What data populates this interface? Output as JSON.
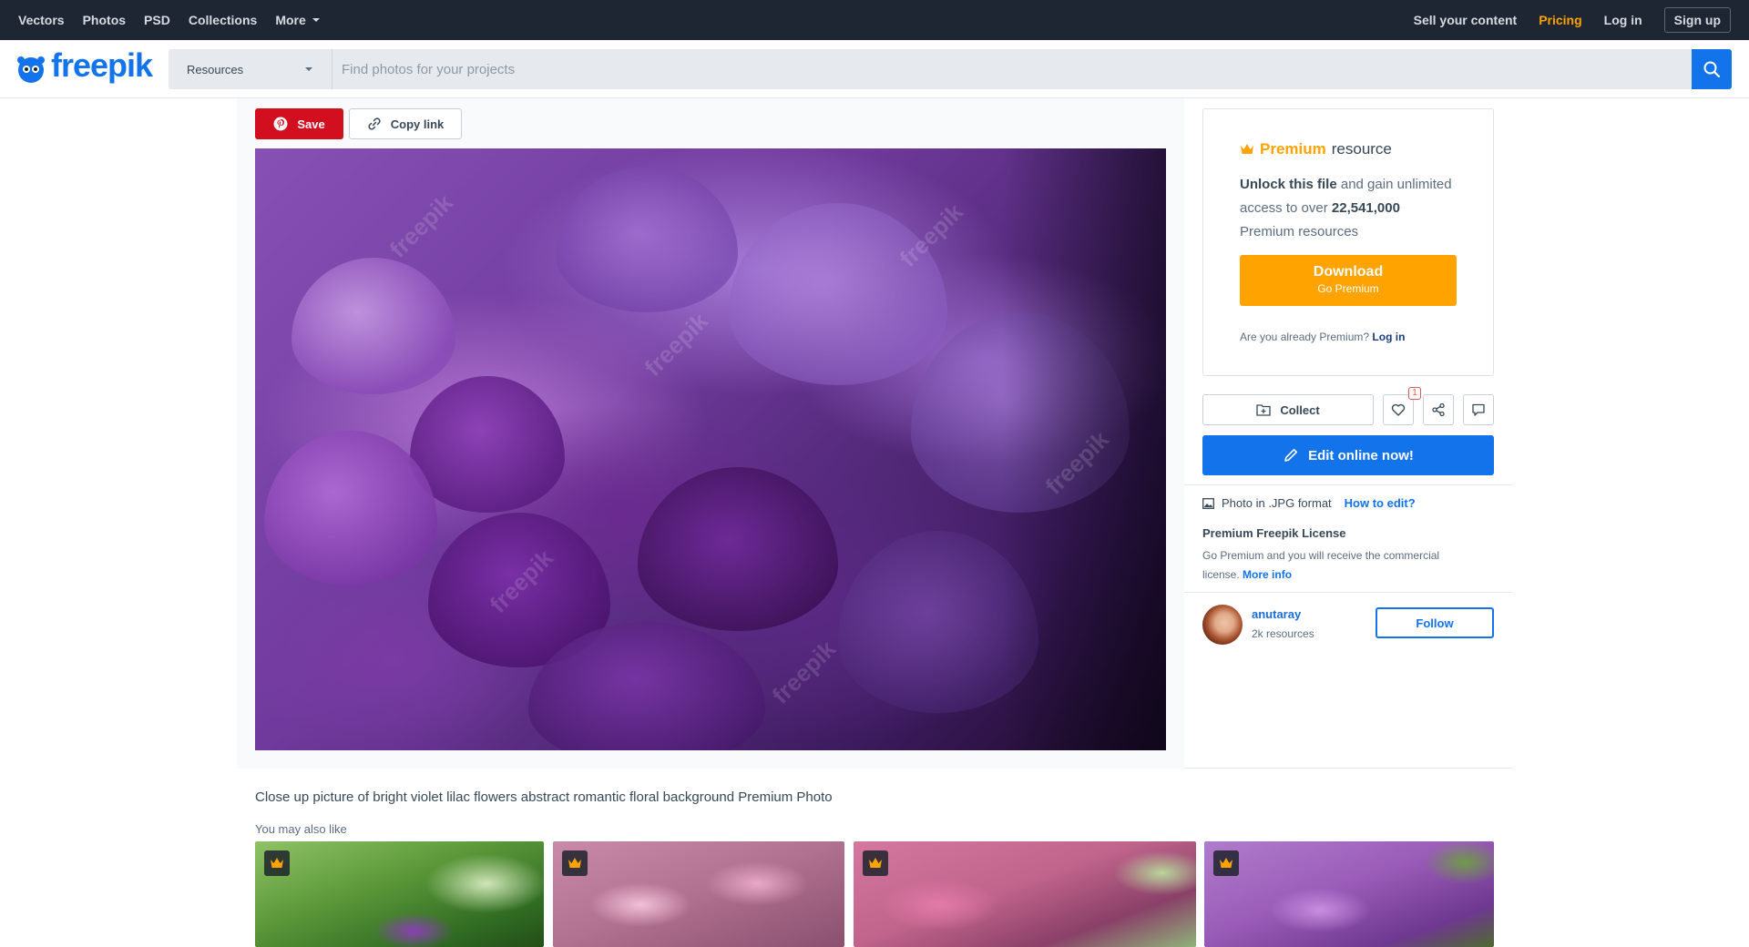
{
  "topbar": {
    "nav": [
      "Vectors",
      "Photos",
      "PSD",
      "Collections"
    ],
    "more": "More",
    "sell": "Sell your content",
    "pricing": "Pricing",
    "login": "Log in",
    "signup": "Sign up"
  },
  "header": {
    "logo": "freepik",
    "resources": "Resources",
    "search_placeholder": "Find photos for your projects"
  },
  "actions": {
    "save": "Save",
    "copy_link": "Copy link"
  },
  "premium": {
    "label": "Premium",
    "resource": "resource",
    "unlock_bold": "Unlock this file",
    "unlock_rest": "and gain unlimited access to over",
    "count": "22,541,000",
    "count_rest": "Premium resources",
    "download": "Download",
    "go_premium": "Go Premium",
    "already": "Are you already Premium?",
    "login": "Log in"
  },
  "tools": {
    "collect": "Collect",
    "likes": "1",
    "edit": "Edit online now!"
  },
  "details": {
    "format": "Photo in .JPG format",
    "how_to_edit": "How to edit?",
    "license_title": "Premium Freepik License",
    "license_text": "Go Premium and you will receive the commercial license.",
    "more_info": "More info"
  },
  "author": {
    "name": "anutaray",
    "resources": "2k resources",
    "follow": "Follow"
  },
  "content": {
    "title": "Close up picture of bright violet lilac flowers abstract romantic floral background Premium Photo",
    "also_like": "You may also like"
  },
  "colors": {
    "accent": "#1273eb",
    "premium": "#ffa300",
    "pinterest": "#d10f1e",
    "topbar": "#1d2632"
  }
}
